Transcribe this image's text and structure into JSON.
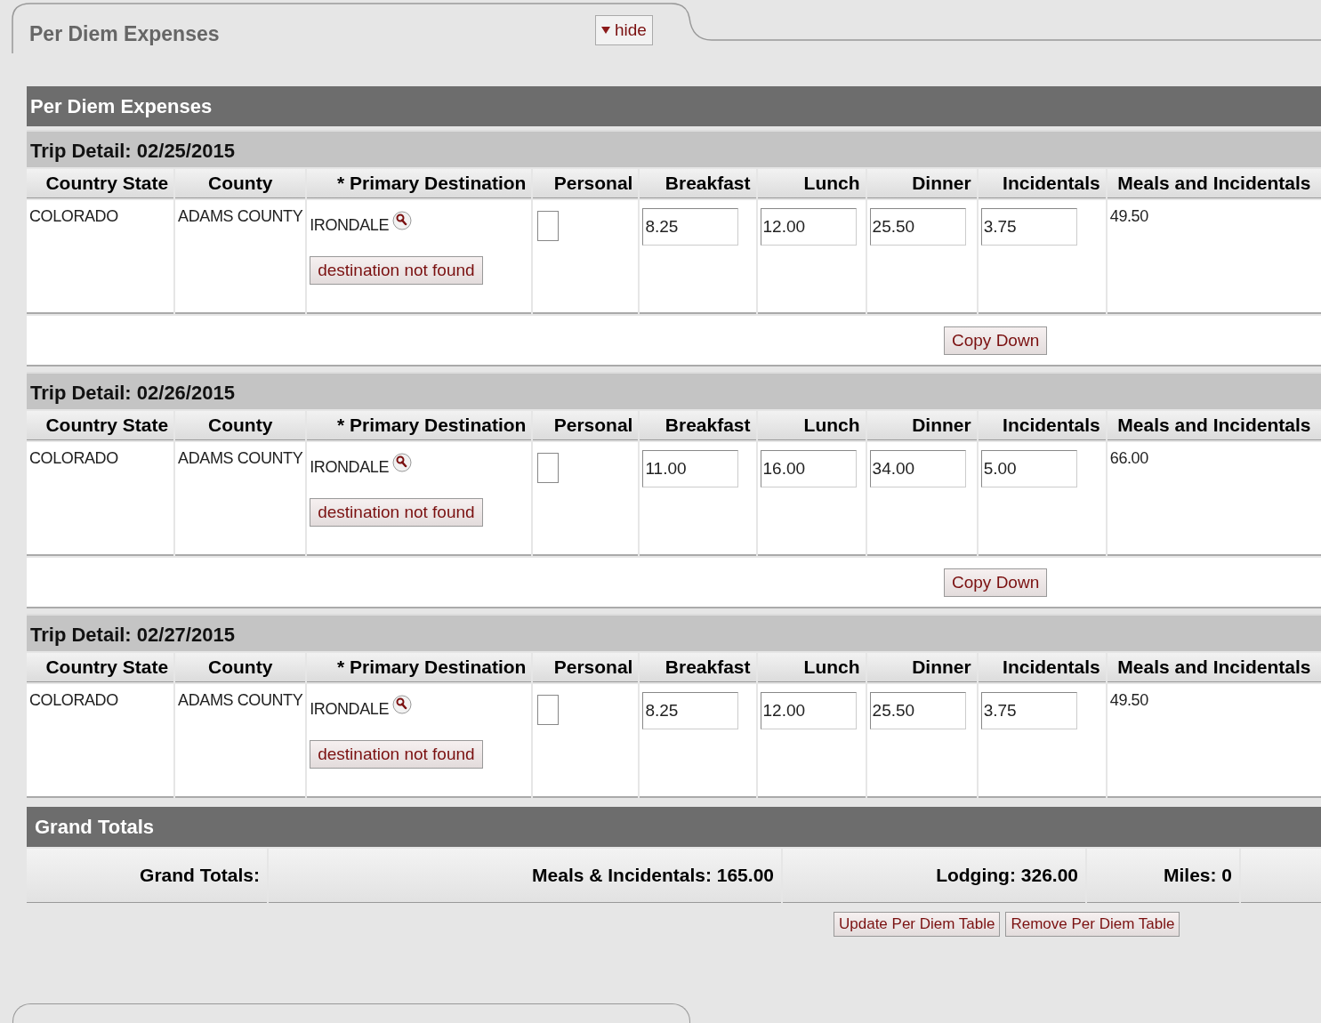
{
  "panel_tab": {
    "title": "Per Diem Expenses",
    "toggle_label": "hide"
  },
  "section": {
    "title": "Per Diem Expenses"
  },
  "trips": [
    {
      "title": "Trip Detail: 02/25/2015",
      "columns": [
        "Country State",
        "County",
        "* Primary Destination",
        "Personal",
        "Breakfast",
        "Lunch",
        "Dinner",
        "Incidentals",
        "Meals and Incidentals"
      ],
      "country_state": "COLORADO",
      "county": "ADAMS COUNTY",
      "primary_destination": "IRONDALE",
      "destination_status": "destination not found",
      "personal": false,
      "breakfast": "8.25",
      "lunch": "12.00",
      "dinner": "25.50",
      "incidentals": "3.75",
      "meals_and_incidentals": "49.50",
      "copy_down_label": "Copy Down"
    },
    {
      "title": "Trip Detail: 02/26/2015",
      "columns": [
        "Country State",
        "County",
        "* Primary Destination",
        "Personal",
        "Breakfast",
        "Lunch",
        "Dinner",
        "Incidentals",
        "Meals and Incidentals"
      ],
      "country_state": "COLORADO",
      "county": "ADAMS COUNTY",
      "primary_destination": "IRONDALE",
      "destination_status": "destination not found",
      "personal": false,
      "breakfast": "11.00",
      "lunch": "16.00",
      "dinner": "34.00",
      "incidentals": "5.00",
      "meals_and_incidentals": "66.00",
      "copy_down_label": "Copy Down"
    },
    {
      "title": "Trip Detail: 02/27/2015",
      "columns": [
        "Country State",
        "County",
        "* Primary Destination",
        "Personal",
        "Breakfast",
        "Lunch",
        "Dinner",
        "Incidentals",
        "Meals and Incidentals"
      ],
      "country_state": "COLORADO",
      "county": "ADAMS COUNTY",
      "primary_destination": "IRONDALE",
      "destination_status": "destination not found",
      "personal": false,
      "breakfast": "8.25",
      "lunch": "12.00",
      "dinner": "25.50",
      "incidentals": "3.75",
      "meals_and_incidentals": "49.50"
    }
  ],
  "grand_totals": {
    "title": "Grand Totals",
    "label": "Grand Totals:",
    "meals_and_incidentals": "Meals & Incidentals: 165.00",
    "lodging": "Lodging: 326.00",
    "miles": "Miles: 0"
  },
  "buttons": [
    "Update Per Diem Table",
    "Remove Per Diem Table"
  ]
}
